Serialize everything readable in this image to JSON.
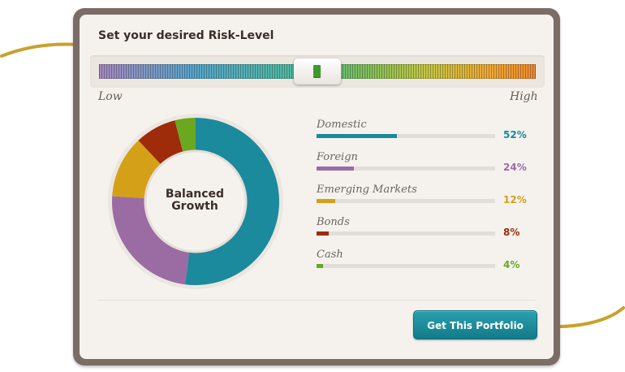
{
  "risk": {
    "title": "Set your desired Risk-Level",
    "low_label": "Low",
    "high_label": "High",
    "level_fraction": 0.5
  },
  "portfolio": {
    "name_line1": "Balanced",
    "name_line2": "Growth",
    "allocations": [
      {
        "label": "Domestic",
        "percent": 52,
        "percent_text": "52%",
        "color": "#1a8a9c"
      },
      {
        "label": "Foreign",
        "percent": 24,
        "percent_text": "24%",
        "color": "#9b6ba4"
      },
      {
        "label": "Emerging Markets",
        "percent": 12,
        "percent_text": "12%",
        "color": "#d4a017"
      },
      {
        "label": "Bonds",
        "percent": 8,
        "percent_text": "8%",
        "color": "#9e2b0a"
      },
      {
        "label": "Cash",
        "percent": 4,
        "percent_text": "4%",
        "color": "#6aa820"
      }
    ]
  },
  "actions": {
    "get_portfolio_label": "Get This Portfolio"
  },
  "colors": {
    "frame": "#7b6c66",
    "panel": "#f5f2ee",
    "button": "#1a8a9c",
    "arrow": "#c9a12c"
  }
}
